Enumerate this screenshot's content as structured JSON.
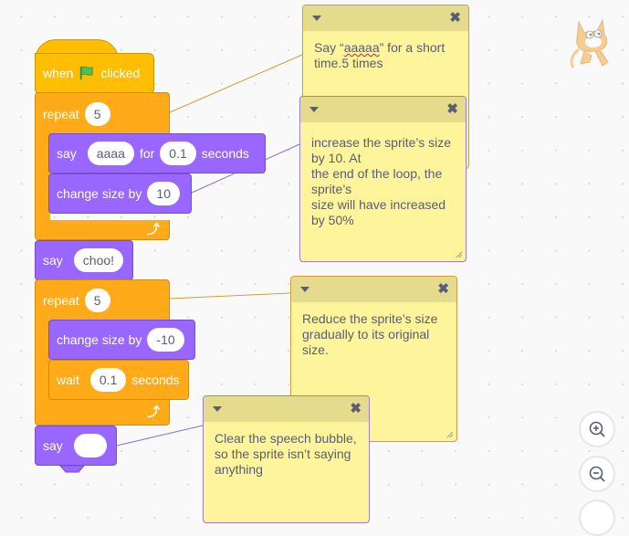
{
  "script": {
    "hat": {
      "when": "when",
      "clicked": "clicked",
      "flag_icon": "green-flag"
    },
    "repeat1": {
      "label": "repeat",
      "count": "5"
    },
    "say_for": {
      "say": "say",
      "text": "aaaa",
      "for": "for",
      "secs": "0.1",
      "seconds": "seconds"
    },
    "change1": {
      "label": "change size by",
      "value": "10"
    },
    "say2": {
      "say": "say",
      "text": "choo!"
    },
    "repeat2": {
      "label": "repeat",
      "count": "5"
    },
    "change2": {
      "label": "change size by",
      "value": "-10"
    },
    "wait": {
      "label": "wait",
      "secs": "0.1",
      "seconds": "seconds"
    },
    "say3": {
      "say": "say",
      "text": ""
    }
  },
  "comments": [
    {
      "pre": "Say “",
      "spell": "aaaaa",
      "post": "” for a short time.5 times"
    },
    {
      "text": "increase the sprite’s size by 10. At\nthe end of the loop, the sprite’s\nsize will have increased by 50%"
    },
    {
      "text": "Reduce the sprite’s size gradually to its original size."
    },
    {
      "text": "Clear the speech bubble, so the sprite isn’t saying anything"
    }
  ],
  "colors": {
    "events": "#ffbf00",
    "control": "#ffab19",
    "looks": "#9966ff",
    "comment": "#fef49c"
  },
  "zoom_controls": {
    "zoom_in": "zoom-in",
    "zoom_out": "zoom-out"
  },
  "sprite": {
    "name": "Scratch Cat"
  }
}
